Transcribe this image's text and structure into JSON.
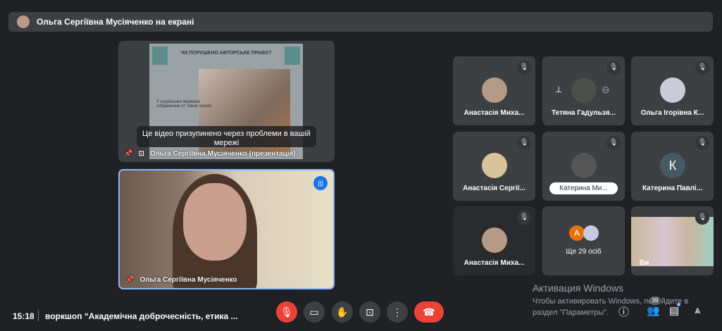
{
  "banner": {
    "text": "Ольга Сергіївна Мусіяченко на екрані"
  },
  "presentation": {
    "slide_title": "ЧИ ПОРУШЕНО АВТОРСЬКЕ ПРАВО?",
    "slide_text": "У соціальних мережах зображення от таким чином:",
    "paused_message": "Це відео призупинено через проблеми в вашій мережі",
    "label": "Ольга Сергіївна Мусіяченко (презентація)"
  },
  "speaker": {
    "label": "Ольга Сергіївна Мусіяченко"
  },
  "participants": [
    {
      "name": "Анастасія Миха..."
    },
    {
      "name": "Тетяна Гадульзя..."
    },
    {
      "name": "Ольга Ігорівна К..."
    },
    {
      "name": "Анастасія Сергії..."
    },
    {
      "name": "Катерина Ми..."
    },
    {
      "name": "Катерина Павлі...",
      "initial": "К"
    },
    {
      "name": "Анастасія Миха..."
    },
    {
      "name": "Ще 29 осіб",
      "initial": "А"
    },
    {
      "name": "Ви"
    }
  ],
  "footer": {
    "time": "15:18",
    "meeting_title": "воркшоп “Академічна доброчесність, етика ...",
    "participant_count": "39"
  },
  "watermark": {
    "title": "Активация Windows",
    "text": "Чтобы активировать Windows, перейдите в раздел \"Параметры\"."
  },
  "colors": {
    "accent": "#8ab4f8",
    "danger": "#ea4335",
    "background": "#202124"
  }
}
